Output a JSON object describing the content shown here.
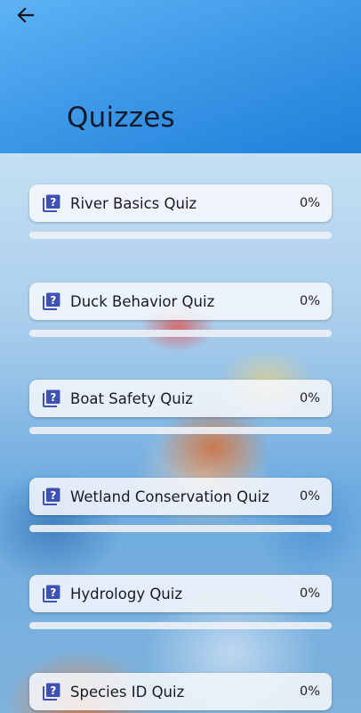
{
  "header": {
    "title": "Quizzes",
    "back_icon": "arrow-left-icon"
  },
  "colors": {
    "header_start": "#5db3f4",
    "header_end": "#1f80d8",
    "icon": "#3f51b5",
    "progress": "#3f51b5"
  },
  "quizzes": [
    {
      "title": "River Basics Quiz",
      "percent_label": "0%",
      "progress": 0,
      "icon": "quiz-icon"
    },
    {
      "title": "Duck Behavior Quiz",
      "percent_label": "0%",
      "progress": 0,
      "icon": "quiz-icon"
    },
    {
      "title": "Boat Safety Quiz",
      "percent_label": "0%",
      "progress": 0,
      "icon": "quiz-icon"
    },
    {
      "title": "Wetland Conservation Quiz",
      "percent_label": "0%",
      "progress": 0,
      "icon": "quiz-icon"
    },
    {
      "title": "Hydrology Quiz",
      "percent_label": "0%",
      "progress": 0,
      "icon": "quiz-icon"
    },
    {
      "title": "Species ID Quiz",
      "percent_label": "0%",
      "progress": 0,
      "icon": "quiz-icon"
    }
  ]
}
